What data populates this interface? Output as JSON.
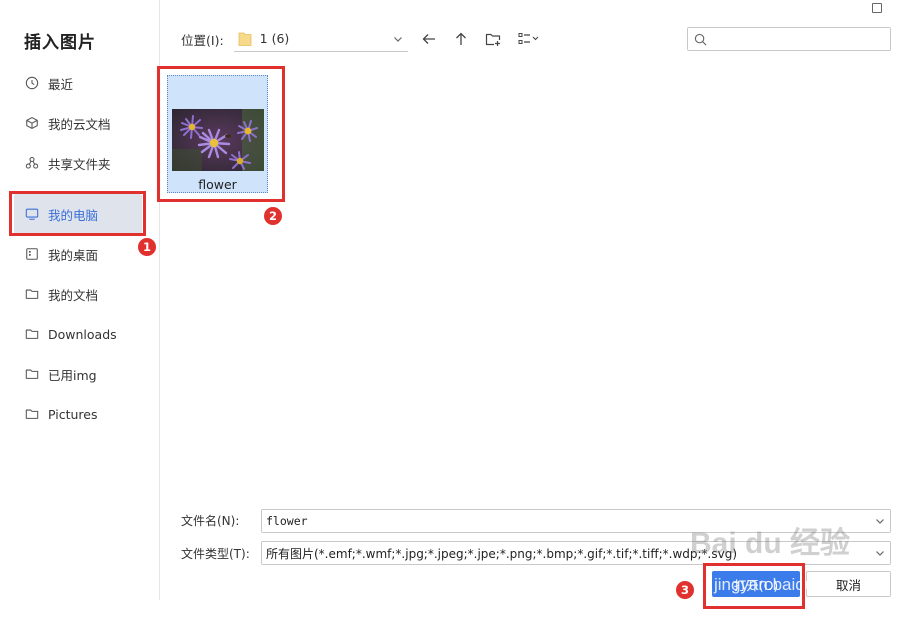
{
  "dialog": {
    "title": "插入图片"
  },
  "sidebar": {
    "items": [
      {
        "label": "最近",
        "icon": "clock-icon"
      },
      {
        "label": "我的云文档",
        "icon": "cube-icon"
      },
      {
        "label": "共享文件夹",
        "icon": "share-icon"
      },
      {
        "label": "我的电脑",
        "icon": "monitor-icon",
        "active": true
      },
      {
        "label": "我的桌面",
        "icon": "desktop-icon"
      },
      {
        "label": "我的文档",
        "icon": "folder-icon"
      },
      {
        "label": "Downloads",
        "icon": "folder-icon"
      },
      {
        "label": "已用img",
        "icon": "folder-icon"
      },
      {
        "label": "Pictures",
        "icon": "folder-icon"
      }
    ]
  },
  "toolbar": {
    "location_label": "位置(I):",
    "location_value": "1 (6)"
  },
  "search": {
    "placeholder": ""
  },
  "files": [
    {
      "name": "flower",
      "selected": true
    }
  ],
  "form": {
    "filename_label": "文件名(N):",
    "filename_value": "flower",
    "filetype_label": "文件类型(T):",
    "filetype_value": "所有图片(*.emf;*.wmf;*.jpg;*.jpeg;*.jpe;*.png;*.bmp;*.gif;*.tif;*.tiff;*.wdp;*.svg)"
  },
  "buttons": {
    "open_label": "打开(O)",
    "cancel_label": "取消"
  },
  "annotations": {
    "badge1": "1",
    "badge2": "2",
    "badge3": "3"
  },
  "watermark": {
    "main": "Bai du 经验",
    "sub": "jingyan.baidu"
  },
  "colors": {
    "accent": "#3b7bea",
    "highlight": "#e0312e",
    "active_bg": "#dfe3ec",
    "selection_bg": "#cfe3fb"
  }
}
